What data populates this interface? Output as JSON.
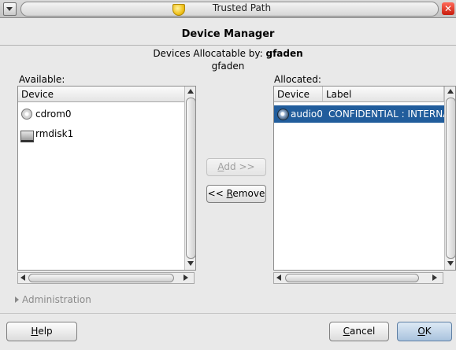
{
  "window": {
    "title": "Trusted Path"
  },
  "dialog": {
    "header": "Device Manager",
    "allocatable_prefix": "Devices Allocatable by: ",
    "allocatable_user": "gfaden",
    "user_line": "gfaden"
  },
  "available": {
    "label": "Available:",
    "column": "Device",
    "items": [
      {
        "name": "cdrom0",
        "icon": "cdrom-icon"
      },
      {
        "name": "rmdisk1",
        "icon": "removable-disk-icon"
      }
    ]
  },
  "allocated": {
    "label": "Allocated:",
    "columns": [
      "Device",
      "Label"
    ],
    "rows": [
      {
        "device": "audio0",
        "label": "CONFIDENTIAL : INTERNA",
        "icon": "audio-icon",
        "selected": true
      }
    ]
  },
  "actions": {
    "add_prefix": "",
    "add_mnemonic": "A",
    "add_rest": "dd >>",
    "remove_prefix": "<< ",
    "remove_mnemonic": "R",
    "remove_rest": "emove"
  },
  "administration": {
    "label": "Administration"
  },
  "footer": {
    "help_mnemonic": "H",
    "help_rest": "elp",
    "cancel_mnemonic": "C",
    "cancel_rest": "ancel",
    "ok_mnemonic": "O",
    "ok_rest": "K"
  },
  "colors": {
    "selection": "#215d9c",
    "close": "#c81c0c",
    "shield": "#f1c21b"
  }
}
